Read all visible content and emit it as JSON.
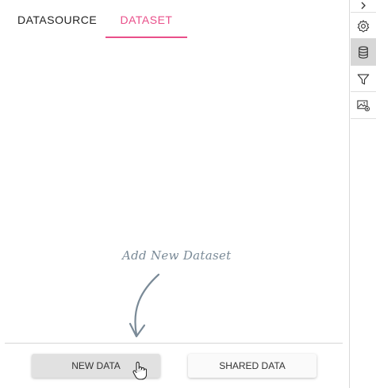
{
  "tabs": {
    "datasource": "DATASOURCE",
    "dataset": "DATASET",
    "active": "dataset"
  },
  "hint": {
    "text": "Add New Dataset"
  },
  "buttons": {
    "new_data": "NEW DATA",
    "shared_data": "SHARED DATA"
  },
  "sidebar": {
    "items": [
      {
        "icon": "chevron-right-icon"
      },
      {
        "icon": "gear-icon"
      },
      {
        "icon": "database-icon",
        "active": true
      },
      {
        "icon": "filter-icon"
      },
      {
        "icon": "image-settings-icon"
      }
    ]
  },
  "colors": {
    "accent": "#e94f8a",
    "hint": "#7a8a97",
    "active_sidebar": "#d7d7d7"
  }
}
